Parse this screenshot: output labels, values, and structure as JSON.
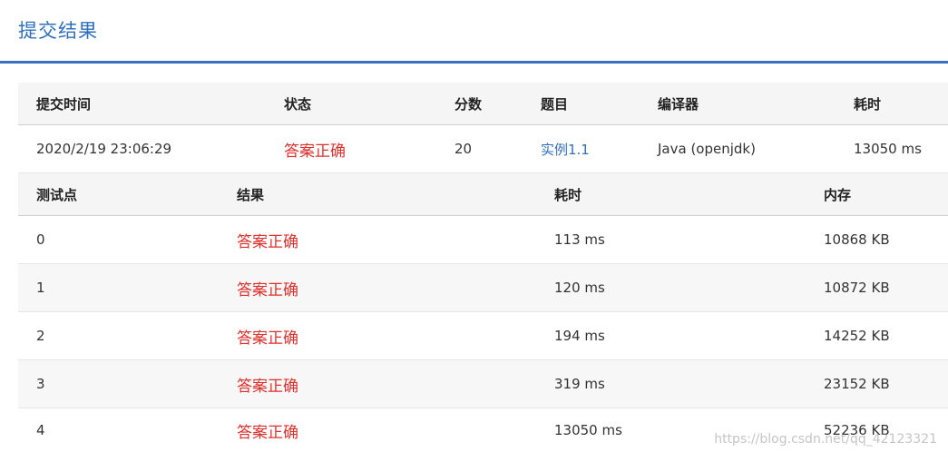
{
  "header": {
    "title": "提交结果"
  },
  "submission": {
    "headers": [
      "提交时间",
      "状态",
      "分数",
      "题目",
      "编译器",
      "耗时"
    ],
    "row": {
      "time": "2020/2/19 23:06:29",
      "status": "答案正确",
      "score": "20",
      "problem": "实例1.1",
      "compiler": "Java (openjdk)",
      "duration": "13050 ms"
    }
  },
  "tests": {
    "headers": [
      "测试点",
      "结果",
      "耗时",
      "内存"
    ],
    "rows": [
      {
        "id": "0",
        "result": "答案正确",
        "time": "113 ms",
        "memory": "10868 KB"
      },
      {
        "id": "1",
        "result": "答案正确",
        "time": "120 ms",
        "memory": "10872 KB"
      },
      {
        "id": "2",
        "result": "答案正确",
        "time": "194 ms",
        "memory": "14252 KB"
      },
      {
        "id": "3",
        "result": "答案正确",
        "time": "319 ms",
        "memory": "23152 KB"
      },
      {
        "id": "4",
        "result": "答案正确",
        "time": "13050 ms",
        "memory": "52236 KB"
      }
    ]
  },
  "watermark": "https://blog.csdn.net/qq_42123321",
  "colors": {
    "accent": "#2f6fbf",
    "success_text": "#e0302c",
    "divider": "#3a6fc4"
  }
}
